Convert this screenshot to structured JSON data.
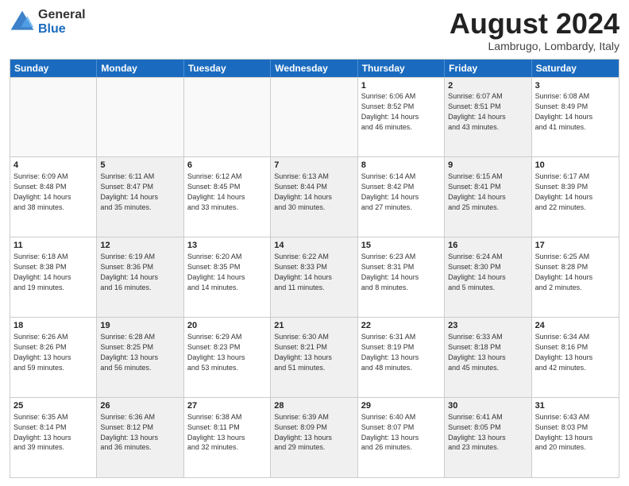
{
  "logo": {
    "general": "General",
    "blue": "Blue"
  },
  "title": "August 2024",
  "location": "Lambrugo, Lombardy, Italy",
  "header_days": [
    "Sunday",
    "Monday",
    "Tuesday",
    "Wednesday",
    "Thursday",
    "Friday",
    "Saturday"
  ],
  "rows": [
    [
      {
        "day": "",
        "text": "",
        "shaded": false,
        "empty": true
      },
      {
        "day": "",
        "text": "",
        "shaded": false,
        "empty": true
      },
      {
        "day": "",
        "text": "",
        "shaded": false,
        "empty": true
      },
      {
        "day": "",
        "text": "",
        "shaded": false,
        "empty": true
      },
      {
        "day": "1",
        "text": "Sunrise: 6:06 AM\nSunset: 8:52 PM\nDaylight: 14 hours\nand 46 minutes.",
        "shaded": false,
        "empty": false
      },
      {
        "day": "2",
        "text": "Sunrise: 6:07 AM\nSunset: 8:51 PM\nDaylight: 14 hours\nand 43 minutes.",
        "shaded": true,
        "empty": false
      },
      {
        "day": "3",
        "text": "Sunrise: 6:08 AM\nSunset: 8:49 PM\nDaylight: 14 hours\nand 41 minutes.",
        "shaded": false,
        "empty": false
      }
    ],
    [
      {
        "day": "4",
        "text": "Sunrise: 6:09 AM\nSunset: 8:48 PM\nDaylight: 14 hours\nand 38 minutes.",
        "shaded": false,
        "empty": false
      },
      {
        "day": "5",
        "text": "Sunrise: 6:11 AM\nSunset: 8:47 PM\nDaylight: 14 hours\nand 35 minutes.",
        "shaded": true,
        "empty": false
      },
      {
        "day": "6",
        "text": "Sunrise: 6:12 AM\nSunset: 8:45 PM\nDaylight: 14 hours\nand 33 minutes.",
        "shaded": false,
        "empty": false
      },
      {
        "day": "7",
        "text": "Sunrise: 6:13 AM\nSunset: 8:44 PM\nDaylight: 14 hours\nand 30 minutes.",
        "shaded": true,
        "empty": false
      },
      {
        "day": "8",
        "text": "Sunrise: 6:14 AM\nSunset: 8:42 PM\nDaylight: 14 hours\nand 27 minutes.",
        "shaded": false,
        "empty": false
      },
      {
        "day": "9",
        "text": "Sunrise: 6:15 AM\nSunset: 8:41 PM\nDaylight: 14 hours\nand 25 minutes.",
        "shaded": true,
        "empty": false
      },
      {
        "day": "10",
        "text": "Sunrise: 6:17 AM\nSunset: 8:39 PM\nDaylight: 14 hours\nand 22 minutes.",
        "shaded": false,
        "empty": false
      }
    ],
    [
      {
        "day": "11",
        "text": "Sunrise: 6:18 AM\nSunset: 8:38 PM\nDaylight: 14 hours\nand 19 minutes.",
        "shaded": false,
        "empty": false
      },
      {
        "day": "12",
        "text": "Sunrise: 6:19 AM\nSunset: 8:36 PM\nDaylight: 14 hours\nand 16 minutes.",
        "shaded": true,
        "empty": false
      },
      {
        "day": "13",
        "text": "Sunrise: 6:20 AM\nSunset: 8:35 PM\nDaylight: 14 hours\nand 14 minutes.",
        "shaded": false,
        "empty": false
      },
      {
        "day": "14",
        "text": "Sunrise: 6:22 AM\nSunset: 8:33 PM\nDaylight: 14 hours\nand 11 minutes.",
        "shaded": true,
        "empty": false
      },
      {
        "day": "15",
        "text": "Sunrise: 6:23 AM\nSunset: 8:31 PM\nDaylight: 14 hours\nand 8 minutes.",
        "shaded": false,
        "empty": false
      },
      {
        "day": "16",
        "text": "Sunrise: 6:24 AM\nSunset: 8:30 PM\nDaylight: 14 hours\nand 5 minutes.",
        "shaded": true,
        "empty": false
      },
      {
        "day": "17",
        "text": "Sunrise: 6:25 AM\nSunset: 8:28 PM\nDaylight: 14 hours\nand 2 minutes.",
        "shaded": false,
        "empty": false
      }
    ],
    [
      {
        "day": "18",
        "text": "Sunrise: 6:26 AM\nSunset: 8:26 PM\nDaylight: 13 hours\nand 59 minutes.",
        "shaded": false,
        "empty": false
      },
      {
        "day": "19",
        "text": "Sunrise: 6:28 AM\nSunset: 8:25 PM\nDaylight: 13 hours\nand 56 minutes.",
        "shaded": true,
        "empty": false
      },
      {
        "day": "20",
        "text": "Sunrise: 6:29 AM\nSunset: 8:23 PM\nDaylight: 13 hours\nand 53 minutes.",
        "shaded": false,
        "empty": false
      },
      {
        "day": "21",
        "text": "Sunrise: 6:30 AM\nSunset: 8:21 PM\nDaylight: 13 hours\nand 51 minutes.",
        "shaded": true,
        "empty": false
      },
      {
        "day": "22",
        "text": "Sunrise: 6:31 AM\nSunset: 8:19 PM\nDaylight: 13 hours\nand 48 minutes.",
        "shaded": false,
        "empty": false
      },
      {
        "day": "23",
        "text": "Sunrise: 6:33 AM\nSunset: 8:18 PM\nDaylight: 13 hours\nand 45 minutes.",
        "shaded": true,
        "empty": false
      },
      {
        "day": "24",
        "text": "Sunrise: 6:34 AM\nSunset: 8:16 PM\nDaylight: 13 hours\nand 42 minutes.",
        "shaded": false,
        "empty": false
      }
    ],
    [
      {
        "day": "25",
        "text": "Sunrise: 6:35 AM\nSunset: 8:14 PM\nDaylight: 13 hours\nand 39 minutes.",
        "shaded": false,
        "empty": false
      },
      {
        "day": "26",
        "text": "Sunrise: 6:36 AM\nSunset: 8:12 PM\nDaylight: 13 hours\nand 36 minutes.",
        "shaded": true,
        "empty": false
      },
      {
        "day": "27",
        "text": "Sunrise: 6:38 AM\nSunset: 8:11 PM\nDaylight: 13 hours\nand 32 minutes.",
        "shaded": false,
        "empty": false
      },
      {
        "day": "28",
        "text": "Sunrise: 6:39 AM\nSunset: 8:09 PM\nDaylight: 13 hours\nand 29 minutes.",
        "shaded": true,
        "empty": false
      },
      {
        "day": "29",
        "text": "Sunrise: 6:40 AM\nSunset: 8:07 PM\nDaylight: 13 hours\nand 26 minutes.",
        "shaded": false,
        "empty": false
      },
      {
        "day": "30",
        "text": "Sunrise: 6:41 AM\nSunset: 8:05 PM\nDaylight: 13 hours\nand 23 minutes.",
        "shaded": true,
        "empty": false
      },
      {
        "day": "31",
        "text": "Sunrise: 6:43 AM\nSunset: 8:03 PM\nDaylight: 13 hours\nand 20 minutes.",
        "shaded": false,
        "empty": false
      }
    ]
  ]
}
